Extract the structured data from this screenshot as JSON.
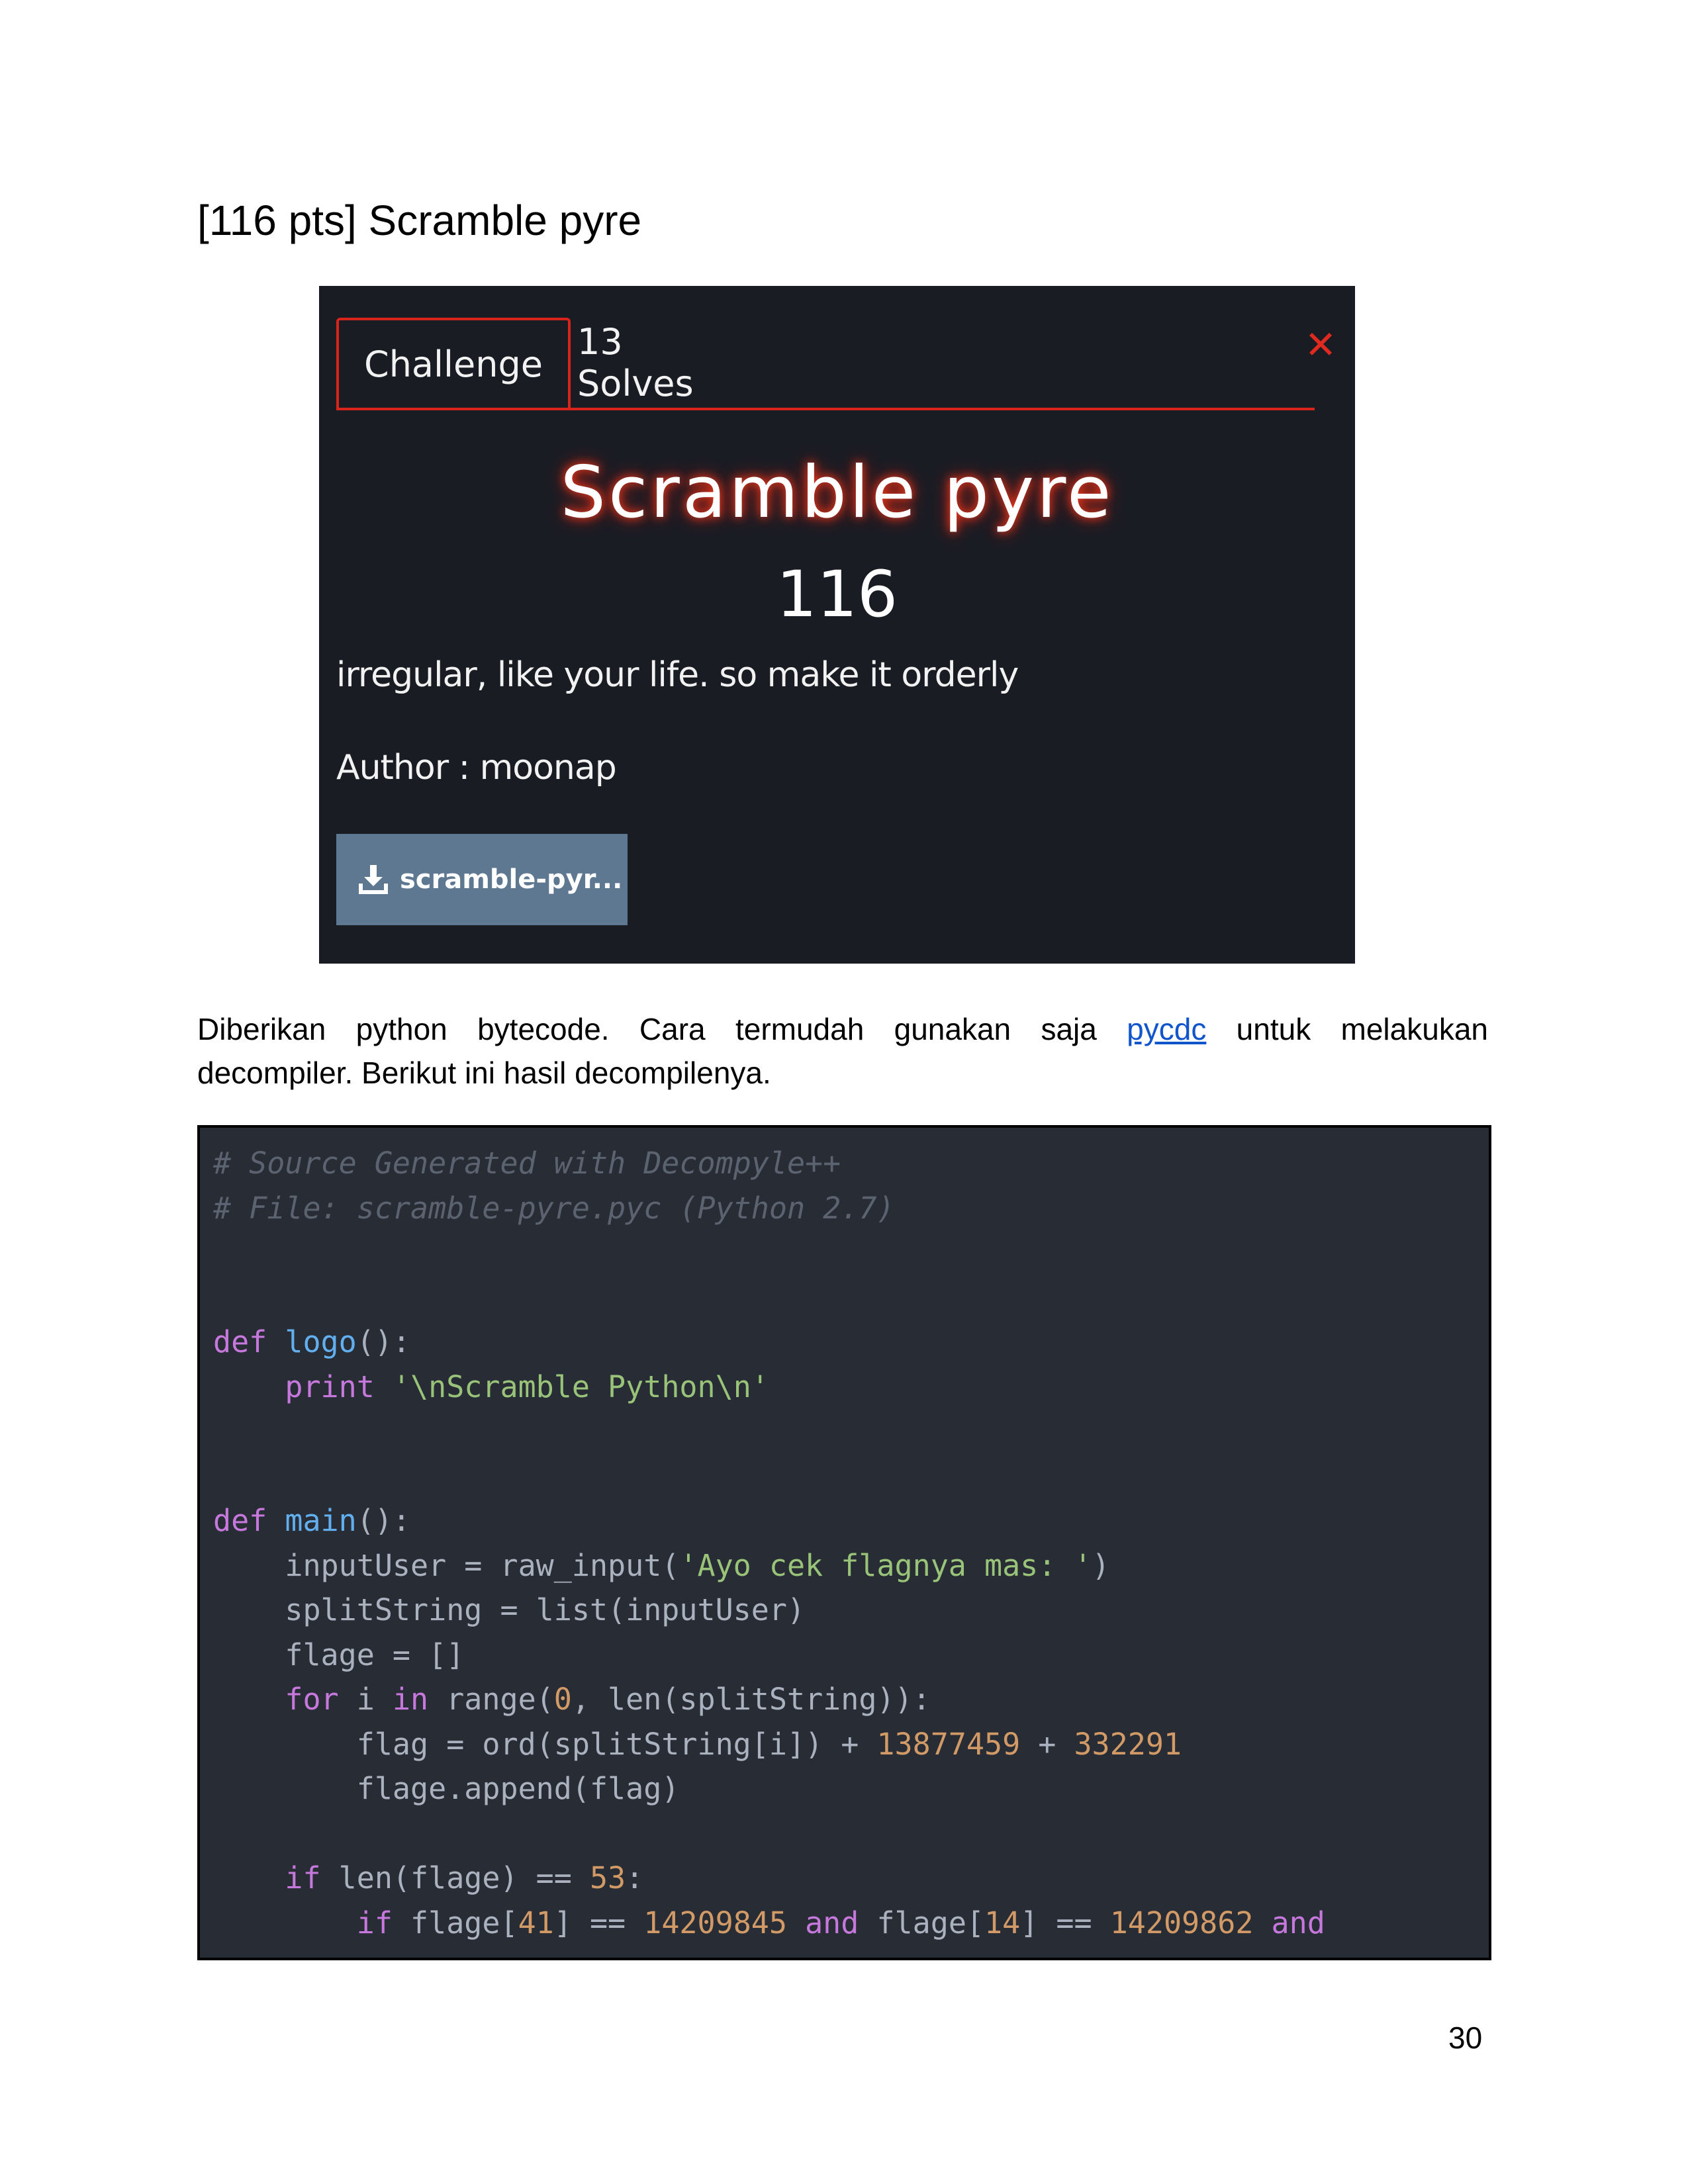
{
  "heading": "[116 pts] Scramble pyre",
  "challenge": {
    "tab_challenge": "Challenge",
    "tab_solves": "13 Solves",
    "close_symbol": "✕",
    "title": "Scramble pyre",
    "points": "116",
    "description": "irregular, like your life. so make it orderly",
    "author": "Author : moonap",
    "download_label": "scramble-pyr...",
    "download_icon": "download-icon",
    "accent_color": "#d9241c",
    "background_color": "#1a1c24",
    "button_color": "#5f7891"
  },
  "paragraph": {
    "words_line1": [
      "Diberikan",
      "python",
      "bytecode.",
      "Cara",
      "termudah",
      "gunakan",
      "saja"
    ],
    "link_text": "pycdc",
    "words_line1_tail": [
      "untuk",
      "melakukan"
    ],
    "line2": "decompiler. Berikut ini hasil decompilenya."
  },
  "code": {
    "comment1": "# Source Generated with Decompyle++",
    "comment2": "# File: scramble-pyre.pyc (Python 2.7)",
    "def": "def",
    "logo_name": "logo",
    "main_name": "main",
    "print_kw": "print",
    "logo_string": "'\\nScramble Python\\n'",
    "input_line_pre": "    inputUser = raw_input(",
    "input_string": "'Ayo cek flagnya mas: '",
    "split_line": "    splitString = list(inputUser)",
    "flage_init": "    flage = []",
    "for_kw": "for",
    "in_kw": "in",
    "range_zero": "0",
    "flag_line_pre": "        flag = ord(splitString[i]) + ",
    "num_a": "13877459",
    "num_b": "332291",
    "append_line": "        flage.append(flag)",
    "if_kw": "if",
    "len_cmp_pre": " len(flage) == ",
    "len_value": "53",
    "idx_a": "41",
    "val_a": "14209845",
    "and_kw": "and",
    "idx_b": "14",
    "val_b": "14209862"
  },
  "page_number": "30"
}
